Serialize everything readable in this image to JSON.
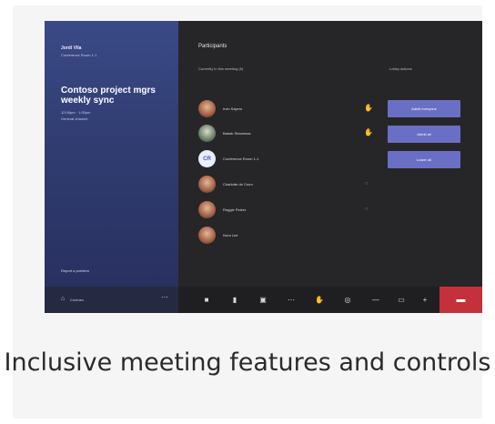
{
  "meeting": {
    "organizer_name": "Jordi Vila",
    "organizer_sub": "Conference Room 1-1",
    "title": "Contoso project mgrs weekly sync",
    "meta_time": "12:00pm · 1:00pm",
    "meta_channel": "General channel",
    "report_label": "Report a problem",
    "bottom_label": "Contoso"
  },
  "participants": {
    "title": "Participants",
    "in_meeting_header": "Currently in this meeting (6)",
    "actions_header": "Lobby actions",
    "list": [
      {
        "name": "Irvin Sayers",
        "status": "hand"
      },
      {
        "name": "Babak Shammas",
        "status": "hand"
      },
      {
        "name": "Conference Room 1-1",
        "initials": "CR",
        "status": ""
      },
      {
        "name": "Charlotte de Crum",
        "status": "muted"
      },
      {
        "name": "Reggie Peters",
        "status": "muted"
      },
      {
        "name": "Nora Lee",
        "status": ""
      }
    ],
    "buttons": [
      "Admit everyone",
      "Admit all",
      "Lower all"
    ]
  },
  "controls": {
    "icons": [
      "camera-icon",
      "mic-icon",
      "share-icon",
      "more-icon",
      "hand-icon",
      "chat-icon",
      "people-icon",
      "settings-icon",
      "plus-icon"
    ],
    "hangup_icon": "phone-hangup-icon"
  },
  "caption": "Inclusive meeting features and controls",
  "colors": {
    "accent": "#6a6fc6",
    "sidebar": "#34427a",
    "hangup": "#c4313b",
    "raised_hand": "#f2c230"
  }
}
